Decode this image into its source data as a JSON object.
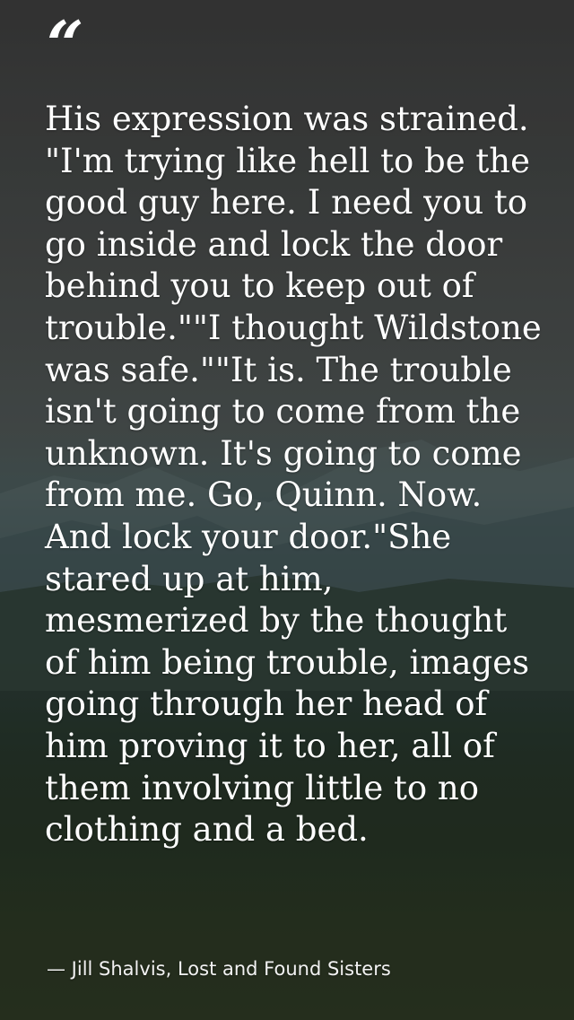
{
  "quote": {
    "open_mark": "“",
    "text": "His expression was strained. \"I'm trying like hell to be the good guy here. I need you to go inside and lock the door behind you to keep out of trouble.\"\"I thought Wildstone was safe.\"\"It is. The trouble isn't going to come from the unknown. It's going to come from me. Go, Quinn. Now. And lock your door.\"She stared up at him, mesmerized by the thought of him being trouble, images going through her head of him proving it to her, all of them involving little to no clothing and a bed.",
    "attribution": "— Jill Shalvis, Lost and Found Sisters"
  },
  "colors": {
    "text": "#ffffff",
    "background_dark": "#3a3a3a",
    "background_green": "#2e3924"
  }
}
